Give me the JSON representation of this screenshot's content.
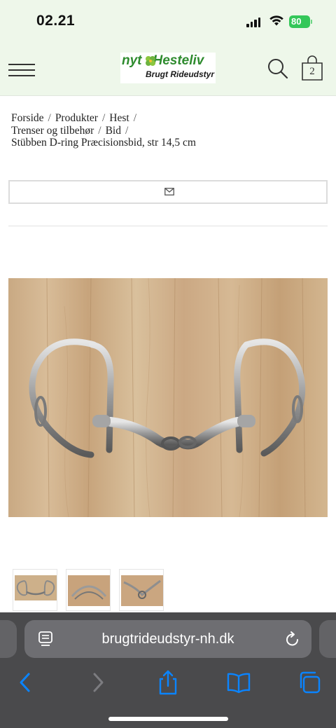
{
  "status": {
    "time": "02.21",
    "battery": "80"
  },
  "header": {
    "logo_line1_prefix": "nyt",
    "logo_line1_suffix": "Hesteliv",
    "logo_line2": "Brugt Rideudstyr",
    "cart_count": "2"
  },
  "breadcrumb": {
    "items": [
      "Forside",
      "Produkter",
      "Hest",
      "Trenser og tilbehør",
      "Bid"
    ],
    "separator": "/",
    "current": "Stübben D-ring Præcisionsbid, str 14,5 cm"
  },
  "browser": {
    "url": "brugtrideudstyr-nh.dk"
  },
  "icons": {
    "menu": "hamburger-icon",
    "search": "search-icon",
    "cart": "shopping-bag-icon",
    "mail": "envelope-icon",
    "reader": "reader-icon",
    "reload": "reload-icon",
    "back": "chevron-left-icon",
    "forward": "chevron-right-icon",
    "share": "share-icon",
    "bookmarks": "book-icon",
    "tabs": "tabs-icon"
  },
  "colors": {
    "header_bg": "#eef7ea",
    "brand_green": "#2e8b2e",
    "ios_blue": "#0a84ff",
    "battery_green": "#34c759"
  }
}
